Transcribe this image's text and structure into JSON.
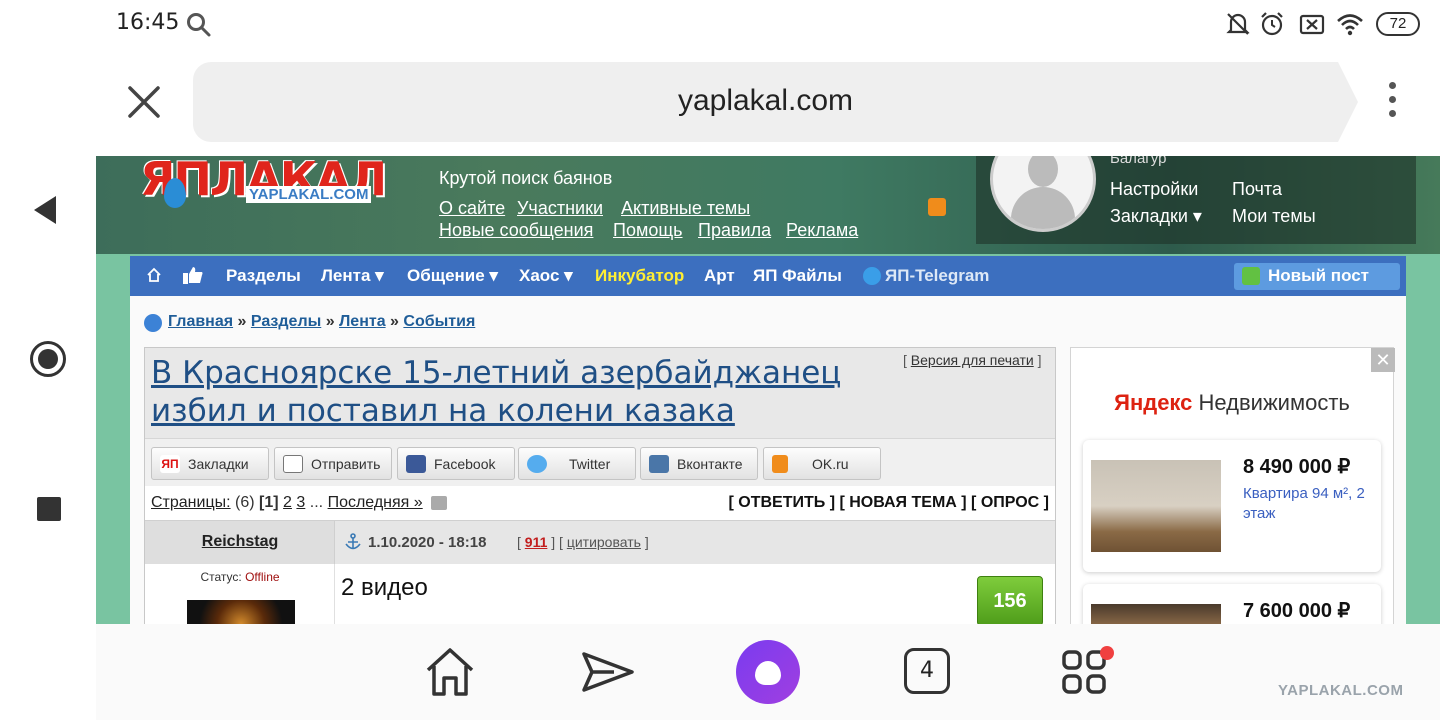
{
  "status_bar": {
    "time": "16:45",
    "battery": "72"
  },
  "browser": {
    "url": "yaplakal.com"
  },
  "site": {
    "logo": "ЯПЛАКАЛ",
    "logo_sub": "YAPLAKAL.COM",
    "search_hint": "Крутой поиск баянов",
    "header_links_row1": [
      "О сайте",
      "Участники",
      "Активные темы"
    ],
    "header_links_row2": [
      "Новые сообщения",
      "Помощь",
      "Правила",
      "Реклама"
    ],
    "user_rank": "Балагур",
    "user_menu": [
      "Настройки",
      "Почта",
      "Закладки ▾",
      "Мои темы"
    ]
  },
  "menu": {
    "items": [
      "Разделы",
      "Лента ▾",
      "Общение ▾",
      "Хаос ▾",
      "Инкубатор",
      "Арт",
      "ЯП Файлы",
      "ЯП-Telegram"
    ],
    "highlight_color": "#ffee33",
    "new_post": "Новый пост"
  },
  "breadcrumb": [
    "Главная",
    "Разделы",
    "Лента",
    "События"
  ],
  "post": {
    "title": "В Красноярске 15-летний азербайджанец избил и поставил на колени казака",
    "print_label": "Версия для печати",
    "share_buttons": [
      "Закладки",
      "Отправить",
      "Facebook",
      "Twitter",
      "Вконтакте",
      "OK.ru"
    ],
    "pages_label": "Страницы:",
    "pages_count": "(6)",
    "current_page": "[1]",
    "pages": [
      "2",
      "3"
    ],
    "pages_ellipsis": "...",
    "last_page": "Последняя »",
    "actions": "[ ОТВЕТИТЬ ] [ НОВАЯ ТЕМА ] [ ОПРОС ]",
    "author": "Reichstag",
    "date": "1.10.2020 - 18:18",
    "post_number": "911",
    "quote_label": "цитировать",
    "status_label": "Статус:",
    "status_value": "Offline",
    "body": "2 видео",
    "rating": "156"
  },
  "ad": {
    "brand_yandex": "Яндекс",
    "brand_product": "Недвижимость",
    "cards": [
      {
        "price": "8 490 000 ₽",
        "desc": "Квартира 94 м², 2 этаж"
      },
      {
        "price": "7 600 000 ₽",
        "desc": ""
      }
    ],
    "close": "✕"
  },
  "bottom_bar": {
    "tabs_count": "4"
  },
  "watermark": "YAPLAKAL.COM"
}
